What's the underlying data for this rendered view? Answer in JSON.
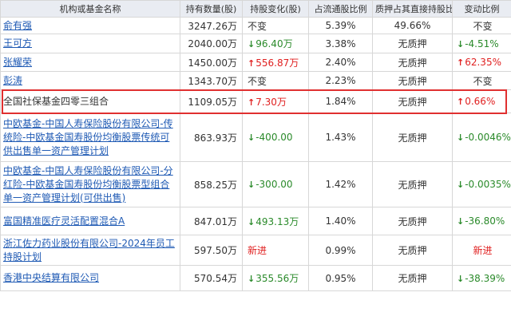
{
  "table": {
    "headers": {
      "name": "机构或基金名称",
      "shares": "持有数量(股)",
      "change": "持股变化(股)",
      "float_pct": "占流通股比例",
      "pledge": "质押占其直接持股比",
      "chg_pct": "变动比例"
    },
    "rows": [
      {
        "name": "俞有强",
        "is_link": true,
        "shares": "3247.26万",
        "change": "不变",
        "change_dir": "none",
        "float_pct": "5.39%",
        "pledge": "49.66%",
        "chg_pct": "不变",
        "chg_dir": "none"
      },
      {
        "name": "王可方",
        "is_link": true,
        "shares": "2040.00万",
        "change": "96.40万",
        "change_dir": "down",
        "float_pct": "3.38%",
        "pledge": "无质押",
        "chg_pct": "-4.51%",
        "chg_dir": "down"
      },
      {
        "name": "张耀荣",
        "is_link": true,
        "shares": "1450.00万",
        "change": "556.87万",
        "change_dir": "up",
        "float_pct": "2.40%",
        "pledge": "无质押",
        "chg_pct": "62.35%",
        "chg_dir": "up"
      },
      {
        "name": "彭涛",
        "is_link": true,
        "shares": "1343.70万",
        "change": "不变",
        "change_dir": "none",
        "float_pct": "2.23%",
        "pledge": "无质押",
        "chg_pct": "不变",
        "chg_dir": "none"
      },
      {
        "name": "全国社保基金四零三组合",
        "is_link": false,
        "shares": "1109.05万",
        "change": "7.30万",
        "change_dir": "up",
        "float_pct": "1.84%",
        "pledge": "无质押",
        "chg_pct": "0.66%",
        "chg_dir": "up"
      },
      {
        "name": "中欧基金-中国人寿保险股份有限公司-传统险-中欧基金国寿股份均衡股票传统可供出售单一资产管理计划",
        "is_link": true,
        "shares": "863.93万",
        "change": "-400.00",
        "change_dir": "down",
        "float_pct": "1.43%",
        "pledge": "无质押",
        "chg_pct": "-0.0046%",
        "chg_dir": "down"
      },
      {
        "name": "中欧基金-中国人寿保险股份有限公司-分红险-中欧基金国寿股份均衡股票型组合单一资产管理计划(可供出售)",
        "is_link": true,
        "shares": "858.25万",
        "change": "-300.00",
        "change_dir": "down",
        "float_pct": "1.42%",
        "pledge": "无质押",
        "chg_pct": "-0.0035%",
        "chg_dir": "down"
      },
      {
        "name": "富国精准医疗灵活配置混合A",
        "is_link": true,
        "shares": "847.01万",
        "change": "493.13万",
        "change_dir": "down",
        "float_pct": "1.40%",
        "pledge": "无质押",
        "chg_pct": "-36.80%",
        "chg_dir": "down"
      },
      {
        "name": "浙江佐力药业股份有限公司-2024年员工持股计划",
        "is_link": true,
        "shares": "597.50万",
        "change": "新进",
        "change_dir": "new",
        "float_pct": "0.99%",
        "pledge": "无质押",
        "chg_pct": "新进",
        "chg_dir": "new"
      },
      {
        "name": "香港中央结算有限公司",
        "is_link": true,
        "shares": "570.54万",
        "change": "355.56万",
        "change_dir": "down",
        "float_pct": "0.95%",
        "pledge": "无质押",
        "chg_pct": "-38.39%",
        "chg_dir": "down"
      }
    ],
    "highlight_row_index": 4,
    "colors": {
      "up": "#e02020",
      "down": "#2a8a2a",
      "link": "#1f5ab4",
      "header_bg": "#e9ecf2",
      "highlight_border": "#e03030"
    }
  }
}
